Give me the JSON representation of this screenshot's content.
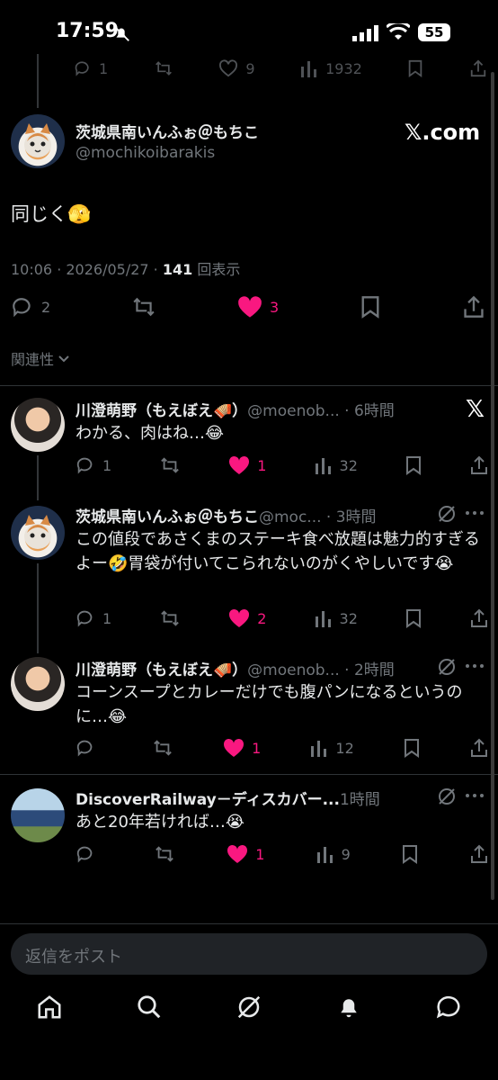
{
  "status_bar": {
    "time": "17:59",
    "battery": "55"
  },
  "prev_actions": {
    "reply": "1",
    "like": "9",
    "views": "1932"
  },
  "main_post": {
    "author_name": "茨城県南いんふぉ＠もちこ",
    "author_handle": "@mochikoibarakis",
    "watermark": "𝕏.com",
    "text": "同じく🫣",
    "meta_time": "10:06 · 2026/05/27 · ",
    "meta_views": "141",
    "meta_views_label": " 回表示",
    "replies": "2",
    "likes": "3"
  },
  "sort_label": "関連性",
  "replies": [
    {
      "name": "川澄萌野（もえぼえ🪗）",
      "handle": "@moenob... · 6時間",
      "text": "わかる、肉はね…😂",
      "reply": "1",
      "like": "1",
      "views": "32"
    },
    {
      "name": "茨城県南いんふぉ＠もちこ",
      "handle": "@moc... · 3時間",
      "text": "この値段であさくまのステーキ食べ放題は魅力的すぎるよー🤣胃袋が付いてこられないのがくやしいです😭",
      "reply": "1",
      "like": "2",
      "views": "32"
    },
    {
      "name": "川澄萌野（もえぼえ🪗）",
      "handle": "@moenob... · 2時間",
      "text": "コーンスープとカレーだけでも腹パンになるというのに…😂",
      "reply": "",
      "like": "1",
      "views": "12"
    },
    {
      "name": "DiscoverRailway－ディスカバー...",
      "handle": "1時間",
      "text": "あと20年若ければ…😭",
      "reply": "",
      "like": "1",
      "views": "9"
    }
  ],
  "reply_placeholder": "返信をポスト",
  "colors": {
    "like": "#f91880",
    "muted": "#71767b",
    "text": "#e7e9ea"
  }
}
